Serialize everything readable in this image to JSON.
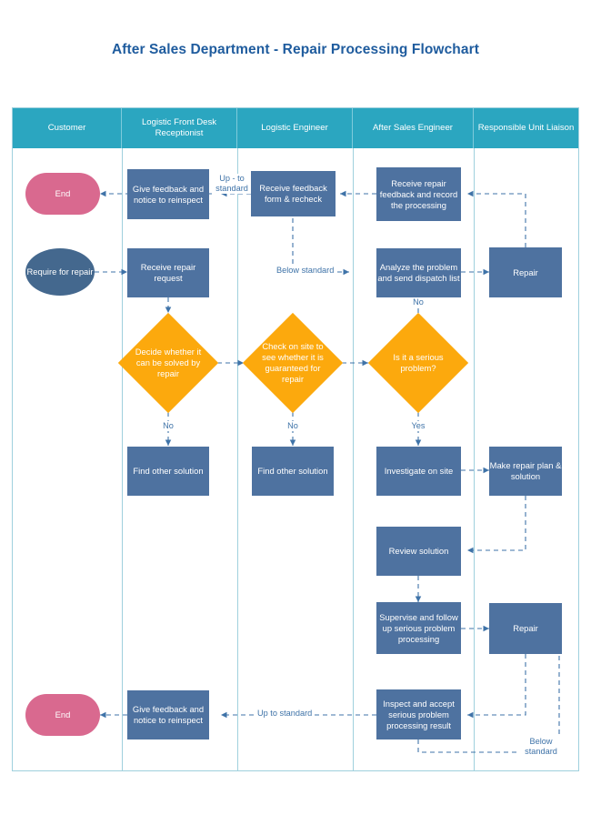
{
  "title": "After Sales Department - Repair Processing Flowchart",
  "colors": {
    "header_band": "#2ba6c0",
    "lane_border": "#9fd0dd",
    "process_fill": "#4e72a0",
    "terminator_fill": "#d9698f",
    "decision_fill": "#fca90d",
    "connector": "#3f73a8",
    "title_text": "#1f5c9e"
  },
  "lanes": [
    {
      "label": "Customer"
    },
    {
      "label": "Logistic Front Desk Receptionist"
    },
    {
      "label": "Logistic Engineer"
    },
    {
      "label": "After Sales Engineer"
    },
    {
      "label": "Responsible Unit Liaison"
    }
  ],
  "nodes": {
    "end_top": "End",
    "give_feedback_top": "Give feedback and notice to reinspect",
    "receive_feedback_recheck": "Receive feedback form & recheck",
    "receive_repair_feedback": "Receive repair feedback and record the processing",
    "require_for_repair": "Require for repair",
    "receive_repair_request": "Receive repair request",
    "analyze_problem": "Analyze the problem and send dispatch list",
    "repair_top": "Repair",
    "decide_whether": "Decide whether it can be solved by repair",
    "check_on_site": "Check on site to see whether it is guaranteed for repair",
    "is_serious": "Is it a serious problem?",
    "find_other_solution_1": "Find other solution",
    "find_other_solution_2": "Find other solution",
    "investigate_on_site": "Investigate on site",
    "make_repair_plan": "Make repair plan & solution",
    "review_solution": "Review solution",
    "supervise_follow_up": "Supervise and follow up serious problem processing",
    "repair_bottom": "Repair",
    "inspect_accept": "Inspect and accept serious problem processing result",
    "give_feedback_bottom": "Give feedback and notice to reinspect",
    "end_bottom": "End"
  },
  "edge_labels": {
    "up_to_standard_top": "Up - to standard",
    "below_standard_mid": "Below standard",
    "no_decide": "No",
    "no_check": "No",
    "no_serious": "No",
    "yes_serious": "Yes",
    "up_to_standard_bottom": "Up to standard",
    "below_standard_bottom": "Below standard"
  }
}
